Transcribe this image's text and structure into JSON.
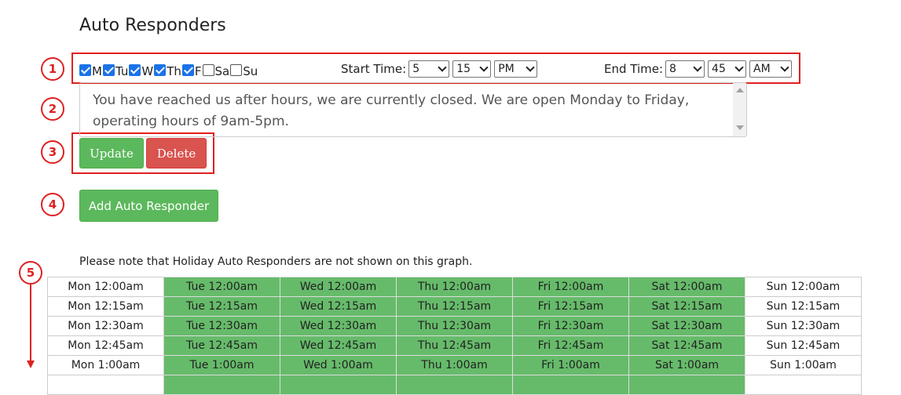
{
  "title": "Auto Responders",
  "callouts": [
    "1",
    "2",
    "3",
    "4",
    "5"
  ],
  "days": [
    {
      "label": "M",
      "checked": true
    },
    {
      "label": "Tu",
      "checked": true
    },
    {
      "label": "W",
      "checked": true
    },
    {
      "label": "Th",
      "checked": true
    },
    {
      "label": "F",
      "checked": true
    },
    {
      "label": "Sa",
      "checked": false
    },
    {
      "label": "Su",
      "checked": false
    }
  ],
  "start_time": {
    "label": "Start Time:",
    "hour": "5",
    "minute": "15",
    "ampm": "PM"
  },
  "end_time": {
    "label": "End Time:",
    "hour": "8",
    "minute": "45",
    "ampm": "AM"
  },
  "message": "You have reached us after hours, we are currently closed. We are open Monday to Friday, operating hours of 9am-5pm.",
  "buttons": {
    "update": "Update",
    "delete": "Delete",
    "add": "Add Auto Responder"
  },
  "note": "Please note that Holiday Auto Responders are not shown on this graph.",
  "schedule": {
    "rows": [
      [
        "Mon 12:00am",
        "Tue 12:00am",
        "Wed 12:00am",
        "Thu 12:00am",
        "Fri 12:00am",
        "Sat 12:00am",
        "Sun 12:00am"
      ],
      [
        "Mon 12:15am",
        "Tue 12:15am",
        "Wed 12:15am",
        "Thu 12:15am",
        "Fri 12:15am",
        "Sat 12:15am",
        "Sun 12:15am"
      ],
      [
        "Mon 12:30am",
        "Tue 12:30am",
        "Wed 12:30am",
        "Thu 12:30am",
        "Fri 12:30am",
        "Sat 12:30am",
        "Sun 12:30am"
      ],
      [
        "Mon 12:45am",
        "Tue 12:45am",
        "Wed 12:45am",
        "Thu 12:45am",
        "Fri 12:45am",
        "Sat 12:45am",
        "Sun 12:45am"
      ],
      [
        "Mon 1:00am",
        "Tue 1:00am",
        "Wed 1:00am",
        "Thu 1:00am",
        "Fri 1:00am",
        "Sat 1:00am",
        "Sun 1:00am"
      ],
      [
        "",
        "",
        "",
        "",
        "",
        "",
        ""
      ]
    ],
    "active_columns": [
      1,
      2,
      3,
      4,
      5
    ]
  },
  "colors": {
    "active": "#66bb6a",
    "accent_red": "#e02020",
    "button_green": "#5cb85c",
    "button_red": "#d9534f",
    "checkbox": "#1a73e8"
  }
}
